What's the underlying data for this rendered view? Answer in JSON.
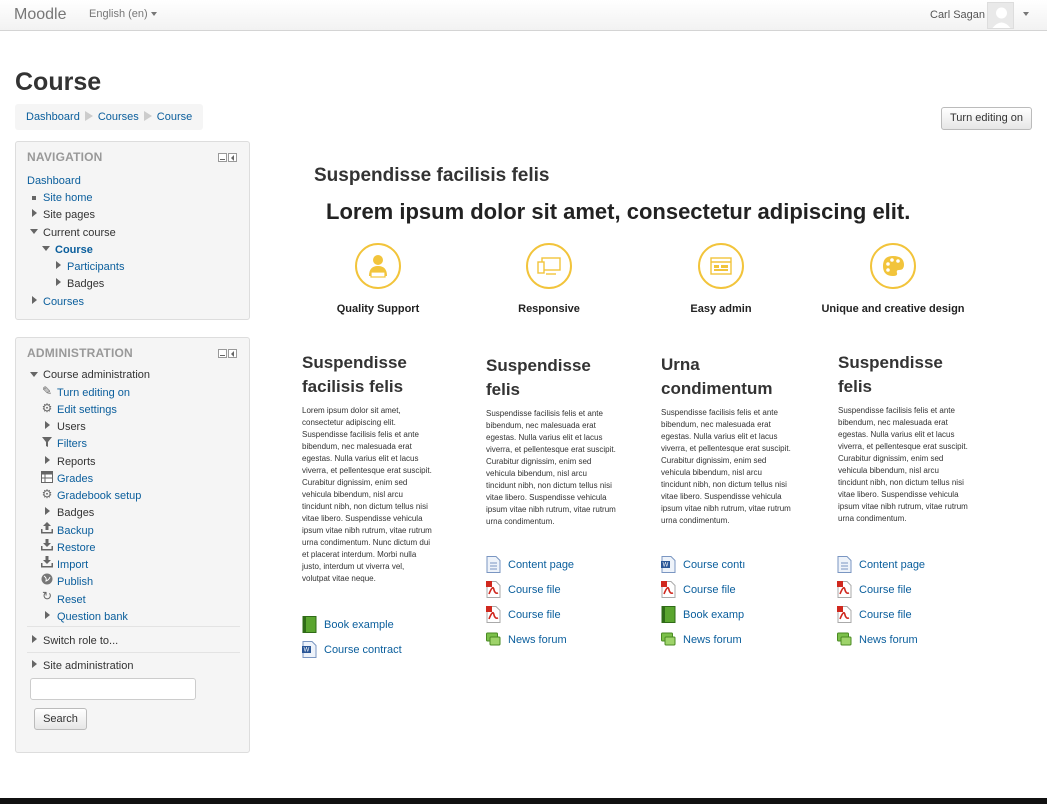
{
  "navbar": {
    "brand": "Moodle",
    "language": "English (en)",
    "user_name": "Carl Sagan"
  },
  "page": {
    "title": "Course",
    "breadcrumb": [
      "Dashboard",
      "Courses",
      "Course"
    ],
    "edit_button": "Turn editing on"
  },
  "navigation": {
    "header": "NAVIGATION",
    "items": [
      "Dashboard",
      "Site home",
      "Site pages",
      "Current course",
      "Course",
      "Participants",
      "Badges",
      "Courses"
    ]
  },
  "administration": {
    "header": "ADMINISTRATION",
    "course_admin": "Course administration",
    "items": [
      "Turn editing on",
      "Edit settings",
      "Users",
      "Filters",
      "Reports",
      "Grades",
      "Gradebook setup",
      "Badges",
      "Backup",
      "Restore",
      "Import",
      "Publish",
      "Reset",
      "Question bank"
    ],
    "switch_role": "Switch role to...",
    "site_admin": "Site administration",
    "search_placeholder": "",
    "search_button": "Search"
  },
  "main": {
    "subtitle": "Suspendisse facilisis felis",
    "headline": "Lorem ipsum dolor sit amet, consectetur adipiscing elit.",
    "features": [
      {
        "label": "Quality Support",
        "icon": "support-agent-icon"
      },
      {
        "label": "Responsive",
        "icon": "devices-icon"
      },
      {
        "label": "Easy admin",
        "icon": "admin-panel-icon"
      },
      {
        "label": "Unique and creative design",
        "icon": "palette-icon"
      }
    ],
    "columns": [
      {
        "title1": "Suspendisse",
        "title2": "facilisis felis",
        "text": "Lorem ipsum dolor sit amet, consectetur adipiscing elit. Suspendisse facilisis felis et ante bibendum, nec malesuada erat egestas. Nulla varius elit et lacus viverra, et pellentesque erat suscipit. Curabitur dignissim, enim sed vehicula bibendum, nisl arcu tincidunt nibh, non dictum tellus nisi vitae libero. Suspendisse vehicula ipsum vitae nibh rutrum, vitae rutrum urna condimentum. Nunc dictum dui et placerat interdum. Morbi nulla justo, interdum ut viverra vel, volutpat vitae neque.",
        "resources": [
          {
            "type": "book",
            "label": "Book example"
          },
          {
            "type": "word",
            "label": "Course contract"
          }
        ]
      },
      {
        "title1": "Suspendisse",
        "title2": "felis",
        "text": "Suspendisse facilisis felis et ante bibendum, nec malesuada erat egestas. Nulla varius elit et lacus viverra, et pellentesque erat suscipit. Curabitur dignissim, enim sed vehicula bibendum, nisl arcu tincidunt nibh, non dictum tellus nisi vitae libero. Suspendisse vehicula ipsum vitae nibh rutrum, vitae rutrum urna condimentum.",
        "resources": [
          {
            "type": "page",
            "label": "Content page"
          },
          {
            "type": "pdf",
            "label": "Course file"
          },
          {
            "type": "pdf",
            "label": "Course file"
          },
          {
            "type": "forum",
            "label": "News forum"
          }
        ]
      },
      {
        "title1": "Urna",
        "title2": "condimentum",
        "text": "Suspendisse facilisis felis et ante bibendum, nec malesuada erat egestas. Nulla varius elit et lacus viverra, et pellentesque erat suscipit. Curabitur dignissim, enim sed vehicula bibendum, nisl arcu tincidunt nibh, non dictum tellus nisi vitae libero. Suspendisse vehicula ipsum vitae nibh rutrum, vitae rutrum urna condimentum.",
        "resources": [
          {
            "type": "word",
            "label": "Course contı"
          },
          {
            "type": "pdf",
            "label": "Course file"
          },
          {
            "type": "book",
            "label": "Book examp"
          },
          {
            "type": "forum",
            "label": "News forum"
          }
        ]
      },
      {
        "title1": "Suspendisse",
        "title2": "felis",
        "text": "Suspendisse facilisis felis et ante bibendum, nec malesuada erat egestas. Nulla varius elit et lacus viverra, et pellentesque erat suscipit. Curabitur dignissim, enim sed vehicula bibendum, nisl arcu tincidunt nibh, non dictum tellus nisi vitae libero. Suspendisse vehicula ipsum vitae nibh rutrum, vitae rutrum urna condimentum.",
        "resources": [
          {
            "type": "page",
            "label": "Content page"
          },
          {
            "type": "pdf",
            "label": "Course file"
          },
          {
            "type": "pdf",
            "label": "Course file"
          },
          {
            "type": "forum",
            "label": "News forum"
          }
        ]
      }
    ]
  },
  "colors": {
    "link": "#0a5e9c",
    "feature_accent": "#f2c43b",
    "block_bg": "#f5f5f5"
  }
}
